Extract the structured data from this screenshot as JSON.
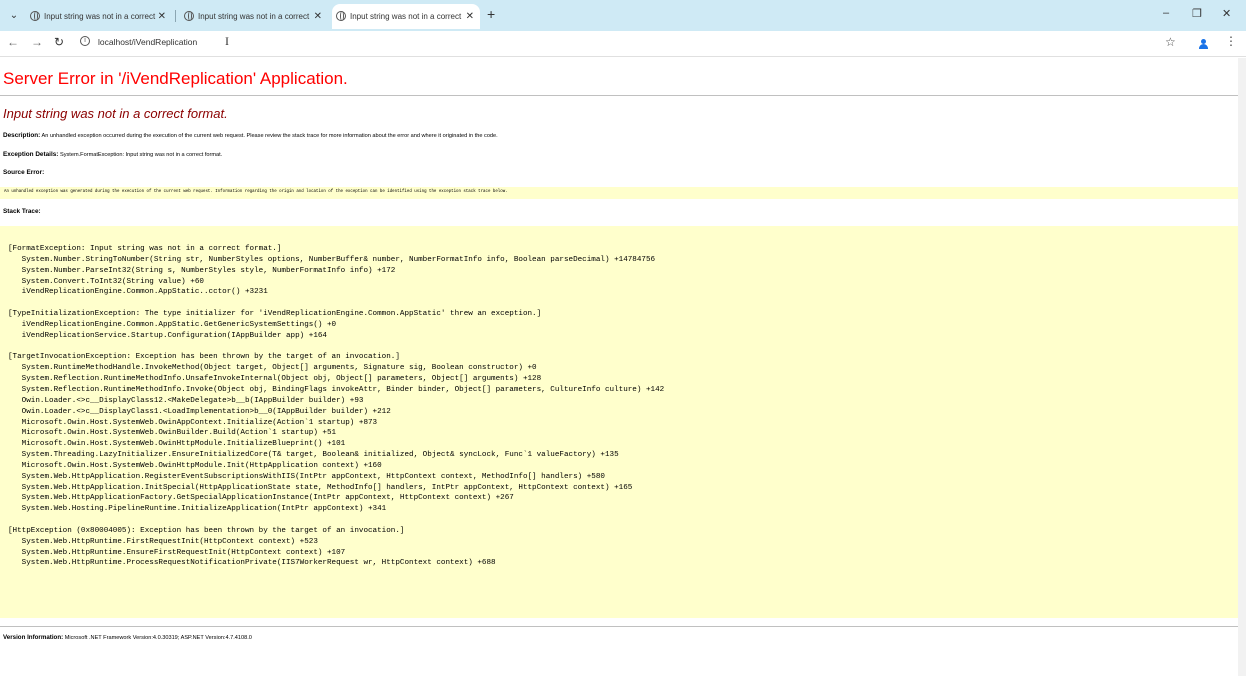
{
  "browser": {
    "tabs": [
      {
        "title": "Input string was not in a correct",
        "active": false
      },
      {
        "title": "Input string was not in a correct",
        "active": false
      },
      {
        "title": "Input string was not in a correct",
        "active": true
      }
    ],
    "tab_close": "✕",
    "new_tab": "+",
    "minimize": "–",
    "restore": "❐",
    "close": "✕",
    "url": "localhost/iVendReplication",
    "back": "←",
    "forward": "→",
    "reload": "↻",
    "bookmark": "☆",
    "menu": "⋮",
    "tab_list": "⌄",
    "info": "i",
    "text_cursor": "I"
  },
  "page": {
    "title": "Server Error in '/iVendReplication' Application.",
    "error_heading": "Input string was not in a correct format.",
    "description_label": "Description:",
    "description_text": "An unhandled exception occurred during the execution of the current web request. Please review the stack trace for more information about the error and where it originated in the code.",
    "exception_label": "Exception Details:",
    "exception_text": "System.FormatException: Input string was not in a correct format.",
    "source_error_label": "Source Error:",
    "source_error_text": "An unhandled exception was generated during the execution of the current web request. Information regarding the origin and location of the exception can be identified using the exception stack trace below.",
    "stack_trace_label": "Stack Trace:",
    "stack_trace": "[FormatException: Input string was not in a correct format.]\n   System.Number.StringToNumber(String str, NumberStyles options, NumberBuffer& number, NumberFormatInfo info, Boolean parseDecimal) +14784756\n   System.Number.ParseInt32(String s, NumberStyles style, NumberFormatInfo info) +172\n   System.Convert.ToInt32(String value) +60\n   iVendReplicationEngine.Common.AppStatic..cctor() +3231\n\n[TypeInitializationException: The type initializer for 'iVendReplicationEngine.Common.AppStatic' threw an exception.]\n   iVendReplicationEngine.Common.AppStatic.GetGenericSystemSettings() +0\n   iVendReplicationService.Startup.Configuration(IAppBuilder app) +164\n\n[TargetInvocationException: Exception has been thrown by the target of an invocation.]\n   System.RuntimeMethodHandle.InvokeMethod(Object target, Object[] arguments, Signature sig, Boolean constructor) +0\n   System.Reflection.RuntimeMethodInfo.UnsafeInvokeInternal(Object obj, Object[] parameters, Object[] arguments) +128\n   System.Reflection.RuntimeMethodInfo.Invoke(Object obj, BindingFlags invokeAttr, Binder binder, Object[] parameters, CultureInfo culture) +142\n   Owin.Loader.<>c__DisplayClass12.<MakeDelegate>b__b(IAppBuilder builder) +93\n   Owin.Loader.<>c__DisplayClass1.<LoadImplementation>b__0(IAppBuilder builder) +212\n   Microsoft.Owin.Host.SystemWeb.OwinAppContext.Initialize(Action`1 startup) +873\n   Microsoft.Owin.Host.SystemWeb.OwinBuilder.Build(Action`1 startup) +51\n   Microsoft.Owin.Host.SystemWeb.OwinHttpModule.InitializeBlueprint() +101\n   System.Threading.LazyInitializer.EnsureInitializedCore(T& target, Boolean& initialized, Object& syncLock, Func`1 valueFactory) +135\n   Microsoft.Owin.Host.SystemWeb.OwinHttpModule.Init(HttpApplication context) +160\n   System.Web.HttpApplication.RegisterEventSubscriptionsWithIIS(IntPtr appContext, HttpContext context, MethodInfo[] handlers) +580\n   System.Web.HttpApplication.InitSpecial(HttpApplicationState state, MethodInfo[] handlers, IntPtr appContext, HttpContext context) +165\n   System.Web.HttpApplicationFactory.GetSpecialApplicationInstance(IntPtr appContext, HttpContext context) +267\n   System.Web.Hosting.PipelineRuntime.InitializeApplication(IntPtr appContext) +341\n\n[HttpException (0x80004005): Exception has been thrown by the target of an invocation.]\n   System.Web.HttpRuntime.FirstRequestInit(HttpContext context) +523\n   System.Web.HttpRuntime.EnsureFirstRequestInit(HttpContext context) +107\n   System.Web.HttpRuntime.ProcessRequestNotificationPrivate(IIS7WorkerRequest wr, HttpContext context) +688",
    "version_label": "Version Information:",
    "version_text": "Microsoft .NET Framework Version:4.0.30319; ASP.NET Version:4.7.4108.0"
  }
}
